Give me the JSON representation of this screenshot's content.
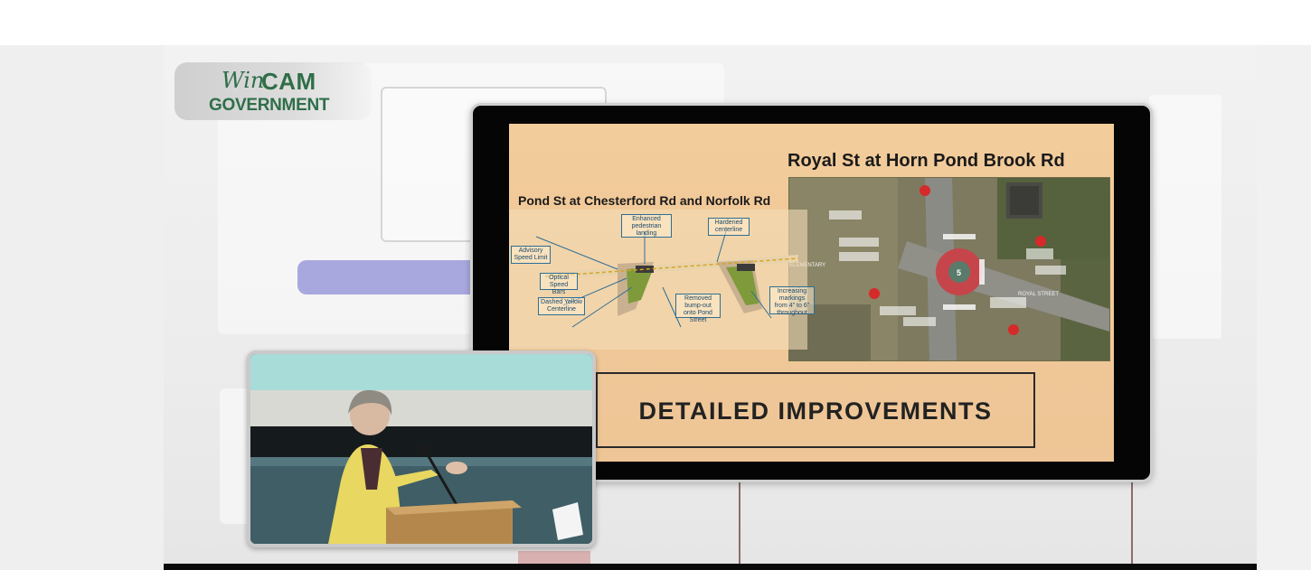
{
  "video": {
    "logo": {
      "script_text": "Win",
      "bold_text": "CAM",
      "subtitle": "GOVERNMENT"
    },
    "slide": {
      "title_right": "Royal St at Horn Pond Brook Rd",
      "title_left": "Pond St at Chesterford Rd and Norfolk Rd",
      "callouts": [
        "Advisory Speed Limit",
        "Enhanced pedestrian landing",
        "Hardened centerline",
        "Optical Speed Bars",
        "Dashed Yellow Centerline",
        "Removed bump-out onto Pond Street",
        "Increasing markings from 4\" to 6\" throughout"
      ],
      "banner": "DETAILED IMPROVEMENTS",
      "aerial_labels": {
        "street": "ROYAL STREET",
        "roundabout_number": "5",
        "school": "ELEMENTARY"
      }
    },
    "inset": {
      "description_icon": "speaker-at-podium"
    },
    "colors": {
      "logo_green": "#2f6e49",
      "slide_background": "#f3cc9b",
      "monitor_bezel": "#050505"
    }
  }
}
